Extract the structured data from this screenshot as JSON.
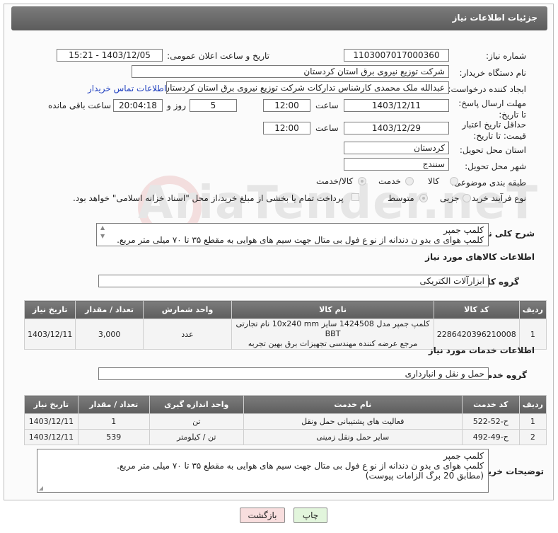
{
  "header": {
    "title": "جزئیات اطلاعات نیاز"
  },
  "form": {
    "need_number_label": "شماره نیاز:",
    "need_number": "1103007017000360",
    "announce_label": "تاریخ و ساعت اعلان عمومی:",
    "announce_value": "1403/12/05 - 15:21",
    "buyer_org_label": "نام دستگاه خریدار:",
    "buyer_org": "شرکت توزیع نیروی برق استان کردستان",
    "creator_label": "ایجاد کننده درخواست:",
    "creator": "عبدالله ملک محمدی کارشناس تدارکات شرکت توزیع نیروی برق استان کردستان",
    "contact_link": "اطلاعات تماس خریدار",
    "deadline_label": "مهلت ارسال پاسخ: تا تاریخ:",
    "deadline_date": "1403/12/11",
    "time_label": "ساعت",
    "deadline_time": "12:00",
    "days_value": "5",
    "days_label": "روز و",
    "remaining_time": "20:04:18",
    "remaining_label": "ساعت باقی مانده",
    "validity_label": "حداقل تاریخ اعتبار قیمت: تا تاریخ:",
    "validity_date": "1403/12/29",
    "validity_time": "12:00",
    "province_label": "استان محل تحویل:",
    "province": "کردستان",
    "city_label": "شهر محل تحویل:",
    "city": "سنندج",
    "category_label": "طبقه بندی موضوعی:",
    "category_options": [
      "کالا",
      "خدمت",
      "کالا/خدمت"
    ],
    "purchase_label": "نوع فرآیند خرید :",
    "purchase_options": [
      "جزیی",
      "متوسط"
    ],
    "payment_note": "پرداخت تمام یا بخشی از مبلغ خرید،از محل \"اسناد خزانه اسلامی\" خواهد بود."
  },
  "summary": {
    "label": "شرح کلی نیاز:",
    "line1": "کلمپ جمپر",
    "line2": "کلمپ هوای ی بدو ن دندانه از نو ع فول بی متال جهت سیم های هوایی به مقطع ۳۵ تا ۷۰ میلی متر مربع."
  },
  "goods": {
    "section_title": "اطلاعات کالاهای مورد نیاز",
    "group_label": "گروه کالا:",
    "group_value": "ابزارآلات الکتریکی",
    "headers": [
      "ردیف",
      "کد کالا",
      "نام کالا",
      "واحد شمارش",
      "تعداد / مقدار",
      "تاریخ نیاز"
    ],
    "rows": [
      {
        "row": "1",
        "code": "2286420396210008",
        "name_line1": "کلمپ جمپر مدل 1424508 سایز 10x240 mm نام تجارتی BBT",
        "name_line2": "مرجع عرضه کننده مهندسی تجهیزات برق بهین تجربه",
        "unit": "عدد",
        "qty": "3,000",
        "date": "1403/12/11"
      }
    ]
  },
  "services": {
    "section_title": "اطلاعات خدمات مورد نیاز",
    "group_label": "گروه خدمت:",
    "group_value": "حمل و نقل و انبارداری",
    "headers": [
      "ردیف",
      "کد خدمت",
      "نام خدمت",
      "واحد اندازه گیری",
      "تعداد / مقدار",
      "تاریخ نیاز"
    ],
    "rows": [
      {
        "row": "1",
        "code": "ح-52-522",
        "name": "فعالیت های پشتیبانی حمل ونقل",
        "unit": "تن",
        "qty": "1",
        "date": "1403/12/11"
      },
      {
        "row": "2",
        "code": "ح-49-492",
        "name": "سایر حمل ونقل زمینی",
        "unit": "تن / کیلومتر",
        "qty": "539",
        "date": "1403/12/11"
      }
    ]
  },
  "notes": {
    "label": "توضیحات خریدار:",
    "line1": "کلمپ جمپر",
    "line2": "کلمپ هوای ی بدو ن دندانه از نو ع فول بی متال جهت سیم های هوایی به مقطع ۳۵ تا ۷۰ میلی متر مربع.",
    "line3": "(مطابق 20  برگ الزامات پیوست)"
  },
  "buttons": {
    "print": "چاپ",
    "back": "بازگشت"
  },
  "colors": {
    "link": "#1f3fbf",
    "header_bg": "#666666",
    "back_button": "#f8dede",
    "print_button": "#e2f5dc"
  }
}
